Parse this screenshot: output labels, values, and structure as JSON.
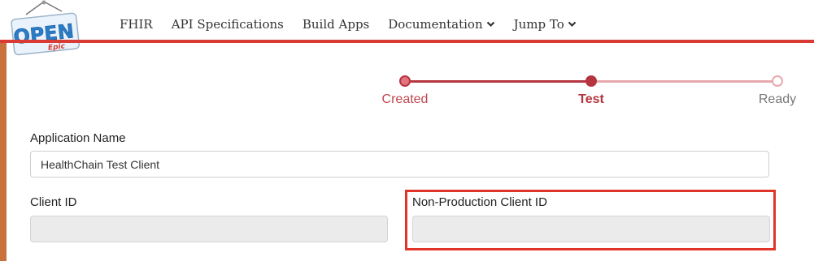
{
  "logo": {
    "main_text": "OPEN",
    "sub_text": "Epic"
  },
  "nav": {
    "items": [
      {
        "label": "FHIR",
        "has_dropdown": false
      },
      {
        "label": "API Specifications",
        "has_dropdown": false
      },
      {
        "label": "Build Apps",
        "has_dropdown": false
      },
      {
        "label": "Documentation",
        "has_dropdown": true
      },
      {
        "label": "Jump To",
        "has_dropdown": true
      }
    ]
  },
  "stepper": {
    "steps": [
      {
        "label": "Created",
        "state": "complete"
      },
      {
        "label": "Test",
        "state": "current"
      },
      {
        "label": "Ready",
        "state": "pending"
      }
    ]
  },
  "form": {
    "application_name_label": "Application Name",
    "application_name_value": "HealthChain Test Client",
    "client_id_label": "Client ID",
    "client_id_value": "",
    "non_production_client_id_label": "Non-Production Client ID",
    "non_production_client_id_value": ""
  },
  "colors": {
    "brand_red": "#d93a34",
    "step_accent": "#b5343f",
    "highlight_box": "#e2352a",
    "logo_blue": "#2a7cc6"
  }
}
